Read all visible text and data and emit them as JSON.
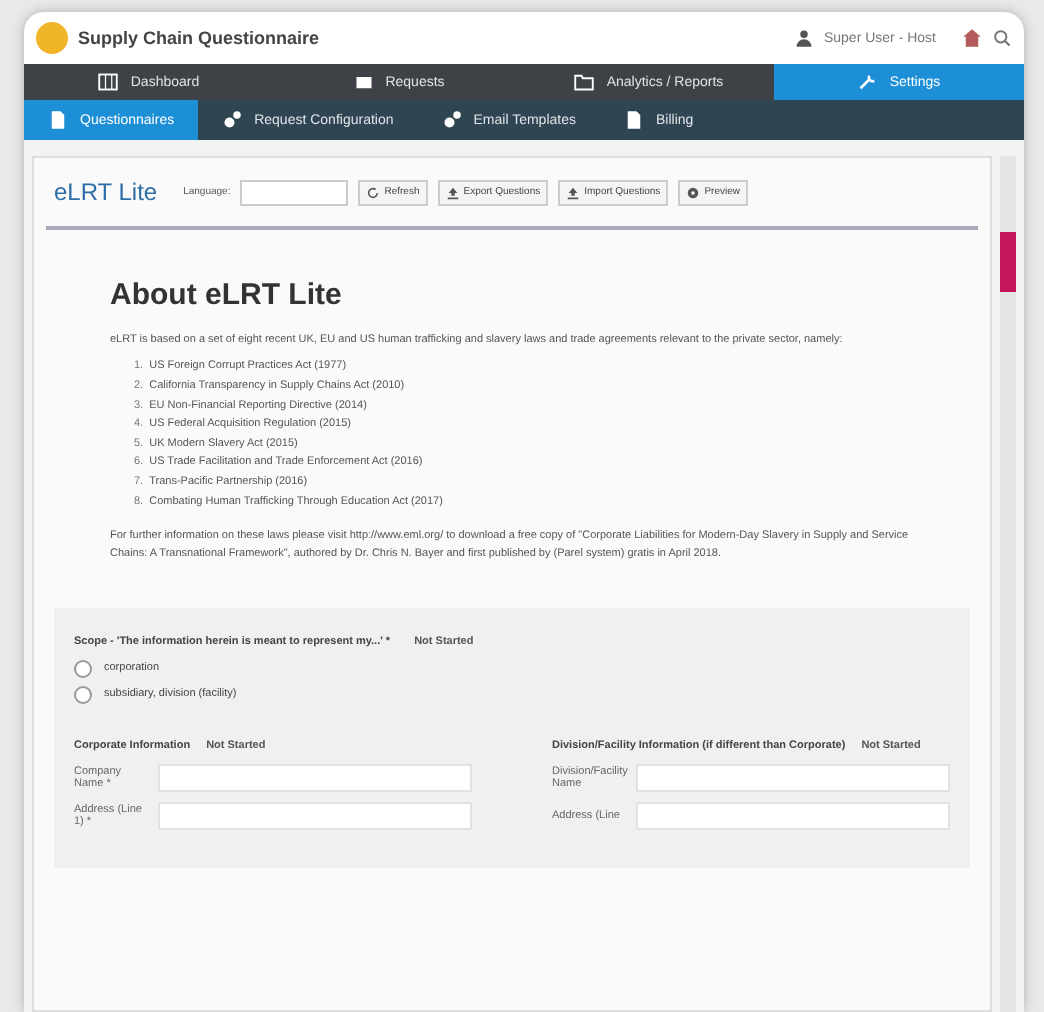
{
  "window": {
    "title": "Supply Chain Questionnaire",
    "user": "Super User - Host"
  },
  "nav": [
    {
      "label": "Dashboard",
      "selected": false
    },
    {
      "label": "Requests",
      "selected": false
    },
    {
      "label": "Analytics / Reports",
      "selected": false
    },
    {
      "label": "Settings",
      "selected": true
    }
  ],
  "subnav": [
    {
      "label": "Questionnaires",
      "selected": true
    },
    {
      "label": "Request Configuration",
      "selected": false
    },
    {
      "label": "Email Templates",
      "selected": false
    },
    {
      "label": "Billing",
      "selected": false
    }
  ],
  "toolbar": {
    "title": "eLRT Lite",
    "language_label": "Language:",
    "buttons": [
      "Refresh",
      "Export Questions",
      "Import Questions",
      "Preview"
    ]
  },
  "about": {
    "heading": "About eLRT Lite",
    "intro": "eLRT is based on a set of eight recent UK, EU and US human trafficking and slavery laws and trade agreements relevant to the private sector, namely:",
    "laws": [
      {
        "number": "1.",
        "text": "US Foreign Corrupt Practices Act (1977)"
      },
      {
        "number": "2.",
        "text": "California Transparency in Supply Chains Act (2010)"
      },
      {
        "number": "3.",
        "text": "EU Non-Financial Reporting Directive (2014)"
      },
      {
        "number": "4.",
        "text": "US Federal Acquisition Regulation (2015)"
      },
      {
        "number": "5.",
        "text": "UK Modern Slavery Act (2015)"
      },
      {
        "number": "6.",
        "text": "US Trade Facilitation and Trade Enforcement Act (2016)"
      },
      {
        "number": "7.",
        "text": "Trans-Pacific Partnership (2016)"
      },
      {
        "number": "8.",
        "text": "Combating Human Trafficking Through Education Act (2017)"
      }
    ],
    "outro": "For further information on these laws please visit http://www.eml.org/ to download a free copy of \"Corporate Liabilities for Modern-Day Slavery in Supply and Service Chains: A Transnational Framework\", authored by Dr. Chris N. Bayer and first published by (Parel system) gratis in April 2018."
  },
  "scope": {
    "question": "Scope - 'The information herein is meant to represent my...' *",
    "status": "Not Started",
    "options": [
      {
        "label": "corporation",
        "selected": false
      },
      {
        "label": "subsidiary, division (facility)",
        "selected": false
      }
    ]
  },
  "sections": [
    {
      "title": "Corporate Information",
      "status": "Not Started",
      "fields": [
        "Company Name *",
        "Address (Line 1) *"
      ]
    },
    {
      "title": "Division/Facility Information (if different than Corporate)",
      "status": "Not Started",
      "fields": [
        "Division/Facility Name",
        "Address (Line"
      ]
    }
  ]
}
